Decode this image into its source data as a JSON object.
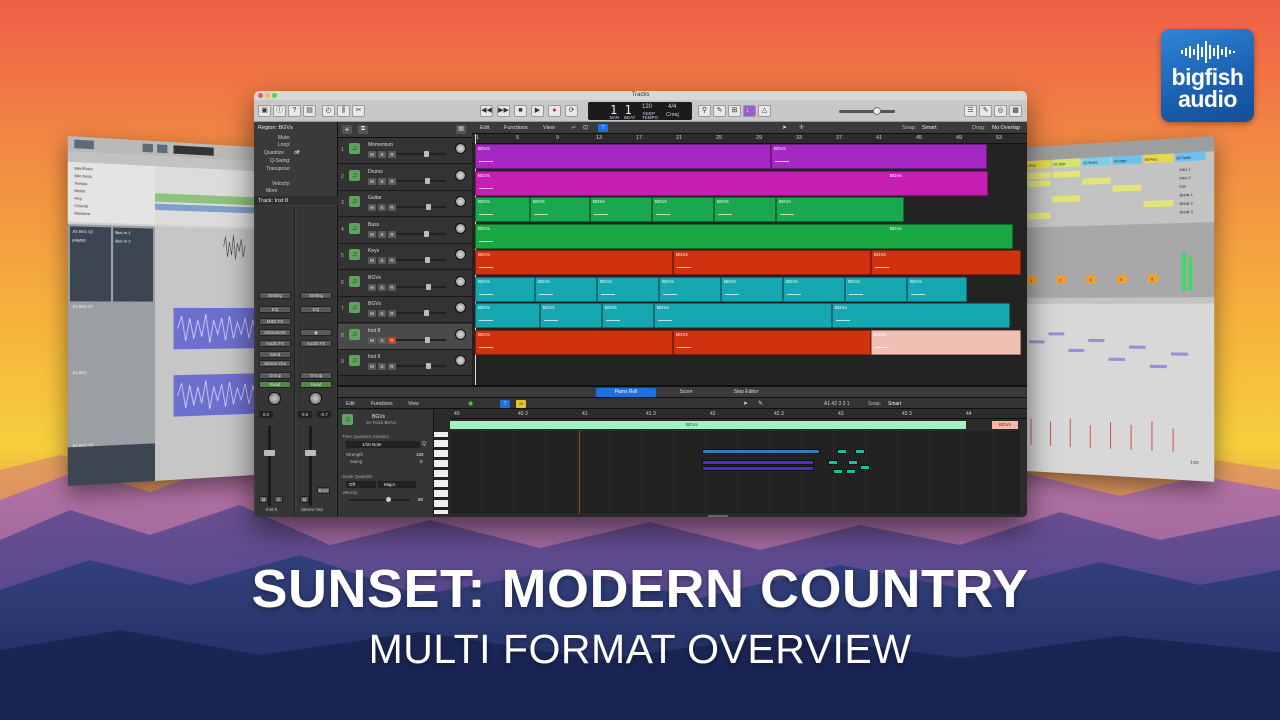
{
  "branding": {
    "logo_line1": "bigfish",
    "logo_line2": "audio",
    "brand_blue": "#1f6fc4"
  },
  "headline": {
    "title": "SUNSET: MODERN COUNTRY",
    "subtitle": "MULTI FORMAT OVERVIEW"
  },
  "colors": {
    "sky_top": "#f06a48",
    "sky_mid": "#f7a23e",
    "sky_low": "#f5c93a",
    "mountain_far": "#9a6aa0",
    "mountain_mid": "#5a4b8c",
    "mountain_near": "#2e3b77"
  },
  "logic": {
    "window_title": "Tracks",
    "lcd": {
      "position": "1  1",
      "bar_label": "BAR",
      "beat_label": "BEAT",
      "tempo": "120",
      "tempo_label": "KEEP",
      "tempo_sub": "TEMPO",
      "signature": "4/4",
      "key": "Cmaj",
      "count_in": "​1234"
    },
    "inspector": {
      "region_label": "Region: BGVs",
      "mute": "Mute:",
      "loop": "Loop:",
      "quantize": "Quantize",
      "quantize_value": "off",
      "q_swing": "Q-Swing:",
      "transpose": "Transpose:",
      "velocity": "Velocity:",
      "more": "More",
      "track_label": "Track: Inst 8",
      "strip_left": {
        "setting": "Setting",
        "eq": "EQ",
        "midi_fx": "MIDI FX",
        "instrument": "Instrument",
        "audio_fx": "Audio FX",
        "send": "Send",
        "output": "Stereo Out",
        "group": "Group",
        "read": "Read",
        "value": "0.0",
        "m": "M",
        "s": "S",
        "name": "Inst 8"
      },
      "strip_right": {
        "setting": "Setting",
        "eq": "EQ",
        "audio_fx": "Audio FX",
        "group": "Group",
        "read": "Read",
        "value": "0.0",
        "value2": "-0.7",
        "m": "M",
        "bnce": "Bnce",
        "name": "Stereo Out"
      }
    },
    "toolbar_menus": {
      "edit": "Edit",
      "functions": "Functions",
      "view": "View",
      "snap_label": "Snap:",
      "snap_value": "Smart",
      "drag_label": "Drag:",
      "drag_value": "No Overlap"
    },
    "ruler": [
      "1",
      "5",
      "9",
      "13",
      "17",
      "21",
      "25",
      "29",
      "33",
      "37",
      "41",
      "45",
      "49",
      "53"
    ],
    "tracks": [
      {
        "num": "1",
        "name": "Momentum",
        "color": "#a528c2"
      },
      {
        "num": "2",
        "name": "Drums",
        "color": "#c61eb3"
      },
      {
        "num": "3",
        "name": "Guitar",
        "color": "#19a84e"
      },
      {
        "num": "4",
        "name": "Bass",
        "color": "#19a842"
      },
      {
        "num": "5",
        "name": "Keys",
        "color": "#d0320f"
      },
      {
        "num": "6",
        "name": "BGVs",
        "color": "#16a8b0"
      },
      {
        "num": "7",
        "name": "BGVs",
        "color": "#16a8b0"
      },
      {
        "num": "8",
        "name": "Inst 8",
        "color": "#d0320f"
      },
      {
        "num": "9",
        "name": "Inst 9",
        "color": "#777777"
      }
    ],
    "region_label": "BGVs",
    "editor": {
      "tab_piano_roll": "Piano Roll",
      "tab_score": "Score",
      "tab_step_editor": "Step Editor",
      "edit": "Edit",
      "functions": "Functions",
      "view": "View",
      "region_name": "BGVs",
      "region_sub": "on Track BGVs",
      "time_quantize_label": "Time Quantize (classic)",
      "time_quantize_value": "1/16 Note",
      "strength_label": "Strength",
      "strength_value": "100",
      "swing_label": "Swing",
      "swing_value": "0",
      "scale_quantize_label": "Scale Quantize",
      "scale_off": "Off",
      "scale_major": "Major",
      "velocity_label": "Velocity",
      "velocity_value": "80",
      "position_readout": "A1   42 3 3 1",
      "snap_label": "Snap:",
      "snap_value": "Smart",
      "ruler": [
        "40",
        "40 3",
        "41",
        "41 3",
        "42",
        "42 3",
        "43",
        "43 3",
        "44"
      ],
      "region_bar_label": "BGVs",
      "region_tag": "BGVs"
    }
  },
  "pro_tools": {
    "tracks_label": [
      "Mkr/Ruler",
      "Min:Secs",
      "Tempo",
      "Meter",
      "Key",
      "Chords",
      "Markers"
    ],
    "track_names": [
      "JG BV1 02",
      "JG BV1 01",
      "JG BV1",
      "JG BV1 03"
    ],
    "btn_labels": [
      "Bus In 1",
      "Bus In 2",
      "playlist"
    ]
  },
  "ableton": {
    "clip_names": [
      "01 Kick",
      "02 Side",
      "03 Snare",
      "04 Hats",
      "05 Perc",
      "06 Tamb"
    ],
    "scene_names": [
      "Intro 1",
      "Intro 2",
      "Full",
      "Break 1",
      "Break 2",
      "Break 3"
    ],
    "page_label": "1/32",
    "track_nums": [
      "1",
      "2",
      "3",
      "4",
      "5"
    ]
  }
}
